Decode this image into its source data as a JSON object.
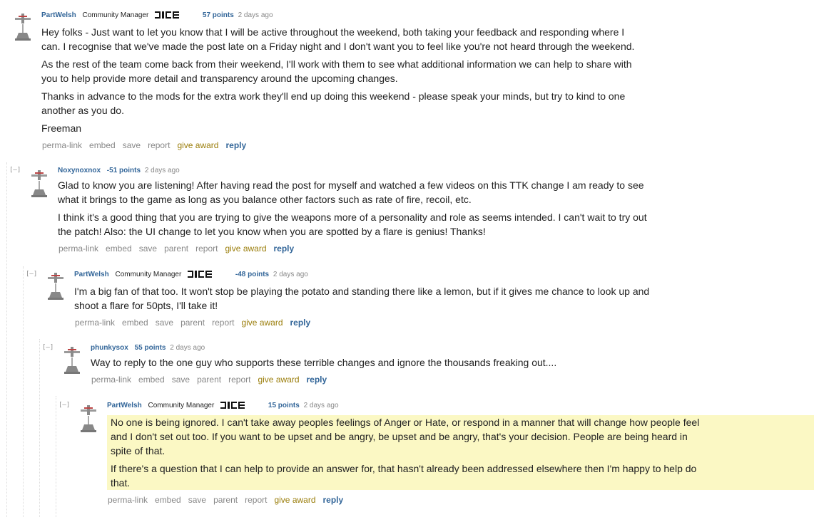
{
  "comments": [
    {
      "author": "PartWelsh",
      "flair": "Community Manager",
      "has_dice": true,
      "score": "57 points",
      "time": "2 days ago",
      "paragraphs": [
        "Hey folks - Just want to let you know that I will be active throughout the weekend, both taking your feedback and responding where I can. I recognise that we've made the post late on a Friday night and I don't want you to feel like you're not heard through the weekend.",
        "As the rest of the team come back from their weekend, I'll work with them to see what additional information we can help to share with you to help provide more detail and transparency around the upcoming changes.",
        "Thanks in advance to the mods for the extra work they'll end up doing this weekend - please speak your minds, but try to kind to one another as you do.",
        "Freeman"
      ],
      "buttons": [
        "perma-link",
        "embed",
        "save",
        "report",
        "give award",
        "reply"
      ]
    },
    {
      "author": "Noxynoxnox",
      "flair": "",
      "has_dice": false,
      "score": "-51 points",
      "time": "2 days ago",
      "collapse": "[–]",
      "paragraphs": [
        "Glad to know you are listening! After having read the post for myself and watched a few videos on this TTK change I am ready to see what it brings to the game as long as you balance other factors such as rate of fire, recoil, etc.",
        "I think it's a good thing that you are trying to give the weapons more of a personality and role as seems intended. I can't wait to try out the patch! Also: the UI change to let you know when you are spotted by a flare is genius! Thanks!"
      ],
      "buttons": [
        "perma-link",
        "embed",
        "save",
        "parent",
        "report",
        "give award",
        "reply"
      ]
    },
    {
      "author": "PartWelsh",
      "flair": "Community Manager",
      "has_dice": true,
      "score": "-48 points",
      "time": "2 days ago",
      "collapse": "[–]",
      "paragraphs": [
        "I'm a big fan of that too. It won't stop be playing the potato and standing there like a lemon, but if it gives me chance to look up and shoot a flare for 50pts, I'll take it!"
      ],
      "buttons": [
        "perma-link",
        "embed",
        "save",
        "parent",
        "report",
        "give award",
        "reply"
      ]
    },
    {
      "author": "phunkysox",
      "flair": "",
      "has_dice": false,
      "score": "55 points",
      "time": "2 days ago",
      "collapse": "[–]",
      "paragraphs": [
        "Way to reply to the one guy who supports these terrible changes and ignore the thousands freaking out...."
      ],
      "buttons": [
        "perma-link",
        "embed",
        "save",
        "parent",
        "report",
        "give award",
        "reply"
      ]
    },
    {
      "author": "PartWelsh",
      "flair": "Community Manager",
      "has_dice": true,
      "score": "15 points",
      "time": "2 days ago",
      "collapse": "[–]",
      "highlight": true,
      "paragraphs": [
        "No one is being ignored. I can't take away peoples feelings of Anger or Hate, or respond in a manner that will change how people feel and I don't set out too. If you want to be upset and be angry, be upset and be angry, that's your decision. People are being heard in spite of that.",
        "If there's a question that I can help to provide an answer for, that hasn't already been addressed elsewhere then I'm happy to help do that."
      ],
      "buttons": [
        "perma-link",
        "embed",
        "save",
        "parent",
        "report",
        "give award",
        "reply"
      ]
    }
  ],
  "colors": {
    "author": "#336699",
    "highlight": "#fbf8c4",
    "award": "#9a7d0a",
    "text": "#222222"
  }
}
